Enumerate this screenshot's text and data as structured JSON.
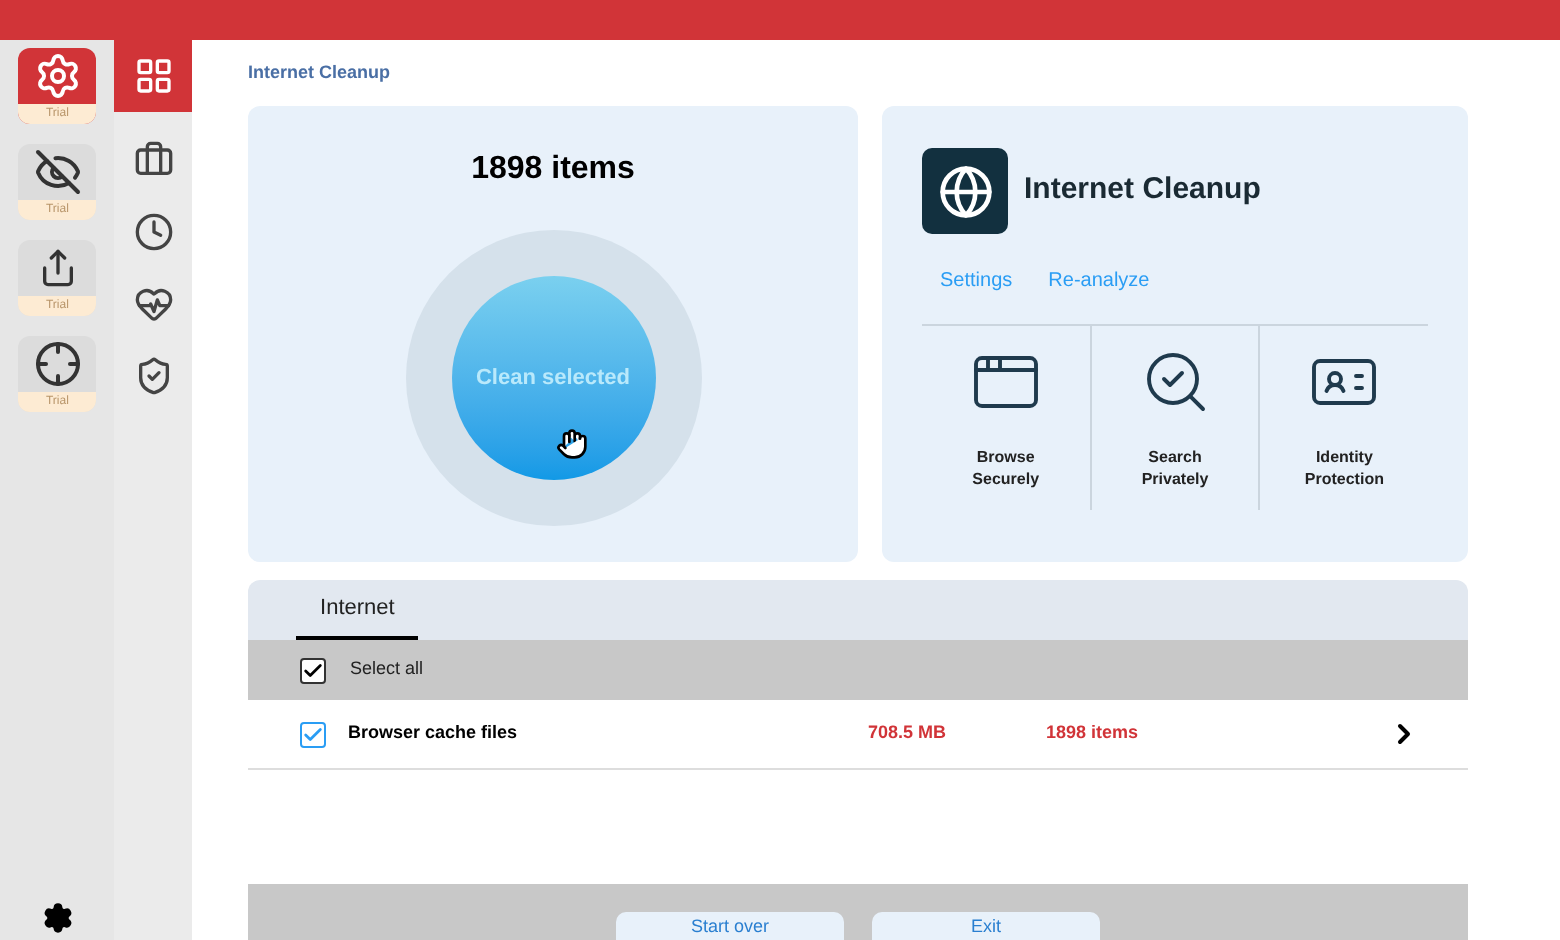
{
  "apps": [
    {
      "kind": "gear",
      "selected": true,
      "badge": "Trial"
    },
    {
      "kind": "eye",
      "selected": false,
      "badge": "Trial"
    },
    {
      "kind": "arrow",
      "selected": false,
      "badge": "Trial"
    },
    {
      "kind": "target",
      "selected": false,
      "badge": "Trial"
    }
  ],
  "nav": [
    {
      "kind": "grid",
      "selected": true
    },
    {
      "kind": "case",
      "selected": false
    },
    {
      "kind": "clock",
      "selected": false
    },
    {
      "kind": "heart",
      "selected": false
    },
    {
      "kind": "shield",
      "selected": false
    }
  ],
  "page_title": "Internet Cleanup",
  "summary": {
    "count": "1898 items",
    "button": "Clean selected"
  },
  "module": {
    "title": "Internet Cleanup",
    "links": [
      "Settings",
      "Re-analyze"
    ],
    "features": [
      {
        "kind": "browse",
        "label": "Browse Securely"
      },
      {
        "kind": "search",
        "label": "Search Privately"
      },
      {
        "kind": "identity",
        "label": "Identity Protection"
      }
    ]
  },
  "tabs": [
    {
      "label": "Internet",
      "selected": true
    }
  ],
  "select_all": {
    "label": "Select all",
    "checked": true
  },
  "rows": [
    {
      "label": "Browser cache files",
      "checked": true,
      "size": "708.5 MB",
      "count": "1898 items"
    }
  ],
  "buttons": [
    "Start over",
    "Exit"
  ]
}
